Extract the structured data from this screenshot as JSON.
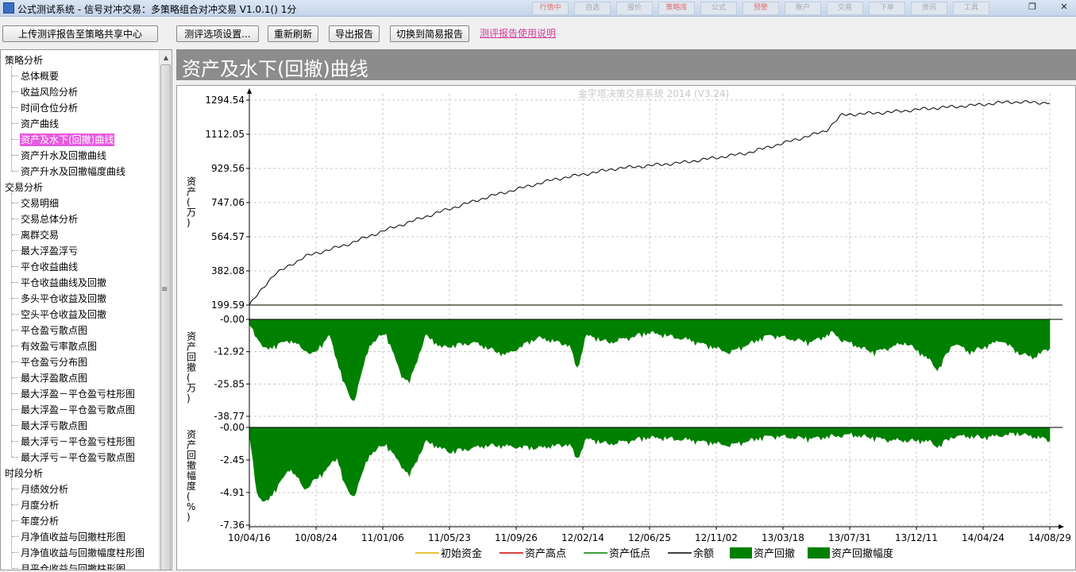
{
  "window": {
    "title": "公式测试系统 - 信号对冲交易：多策略组合对冲交易 V1.0.1() 1分",
    "top_tabs": [
      {
        "label": "行情中",
        "color": "#e07070"
      },
      {
        "label": "自选",
        "color": "#a0a8b0"
      },
      {
        "label": "报价",
        "color": "#a0a8b0"
      },
      {
        "label": "策略库",
        "color": "#e07070"
      },
      {
        "label": "公式",
        "color": "#a0a8b0"
      },
      {
        "label": "预警",
        "color": "#e07070"
      },
      {
        "label": "账户",
        "color": "#a0a8b0"
      },
      {
        "label": "交易",
        "color": "#a0a8b0"
      },
      {
        "label": "下单",
        "color": "#a0a8b0"
      },
      {
        "label": "资讯",
        "color": "#a0a8b0"
      },
      {
        "label": "工具",
        "color": "#a0a8b0"
      }
    ],
    "controls": {
      "restore": "❐",
      "close": "✕"
    }
  },
  "toolbar": {
    "upload": "上传测评报告至策略共享中心",
    "settings": "测评选项设置...",
    "refresh": "重新刷新",
    "export": "导出报告",
    "simple": "切换到简易报告",
    "help_link": "测评报告使用说明"
  },
  "tree": {
    "groups": [
      {
        "label": "策略分析",
        "items": [
          "总体概要",
          "收益风险分析",
          "时间仓位分析",
          "资产曲线",
          "资产及水下(回撤)曲线",
          "资产升水及回撤曲线",
          "资产升水及回撤幅度曲线"
        ]
      },
      {
        "label": "交易分析",
        "items": [
          "交易明细",
          "交易总体分析",
          "离群交易",
          "最大浮盈浮亏",
          "平仓收益曲线",
          "平仓收益曲线及回撤",
          "多头平仓收益及回撤",
          "空头平仓收益及回撤",
          "平仓盈亏散点图",
          "有效盈亏率散点图",
          "平仓盈亏分布图",
          "最大浮盈散点图",
          "最大浮盈－平仓盈亏柱形图",
          "最大浮盈－平仓盈亏散点图",
          "最大浮亏散点图",
          "最大浮亏－平仓盈亏柱形图",
          "最大浮亏－平仓盈亏散点图"
        ]
      },
      {
        "label": "时段分析",
        "items": [
          "月绩效分析",
          "月度分析",
          "年度分析",
          "月净值收益与回撤柱形图",
          "月净值收益与回撤幅度柱形图",
          "月平仓收益与回撤柱形图"
        ]
      }
    ],
    "selected": "资产及水下(回撤)曲线"
  },
  "header": {
    "title": "资产及水下(回撤)曲线"
  },
  "chart_data": {
    "type": "line",
    "watermark": "金字塔决策交易系统 2014 (V3.24)",
    "x_ticks": [
      "10/04/16",
      "10/08/24",
      "11/01/06",
      "11/05/23",
      "11/09/26",
      "12/02/14",
      "12/06/25",
      "12/11/02",
      "13/03/18",
      "13/07/31",
      "13/12/11",
      "14/04/24",
      "14/08/29"
    ],
    "panels": [
      {
        "ylabel": "资产(万)",
        "ylim": [
          199.59,
          1294.54
        ],
        "y_ticks": [
          "1294.54",
          "1112.05",
          "929.56",
          "747.06",
          "564.57",
          "382.08",
          "199.59"
        ],
        "series": [
          {
            "name": "余额",
            "type": "line",
            "color": "#000000",
            "x": [
              0,
              0.03,
              0.07,
              0.12,
              0.17,
              0.24,
              0.3,
              0.38,
              0.46,
              0.54,
              0.62,
              0.68,
              0.72,
              0.74,
              0.8,
              0.85,
              0.9,
              0.95,
              1
            ],
            "y": [
              200,
              360,
              460,
              520,
              600,
              700,
              780,
              870,
              930,
              960,
              1010,
              1080,
              1130,
              1215,
              1230,
              1250,
              1265,
              1285,
              1280
            ]
          },
          {
            "name": "初始资金",
            "type": "line",
            "color": "#e0b000",
            "x": [
              0,
              1
            ],
            "y": [
              200,
              200
            ]
          }
        ]
      },
      {
        "ylabel": "资产回撤(万)",
        "ylim": [
          -38.77,
          0
        ],
        "y_ticks": [
          "-0.00",
          "-12.92",
          "-25.85",
          "-38.77"
        ],
        "series": [
          {
            "name": "资产回撤",
            "type": "area",
            "color": "#008000",
            "x": [
              0,
              0.02,
              0.05,
              0.08,
              0.1,
              0.12,
              0.13,
              0.15,
              0.17,
              0.19,
              0.2,
              0.22,
              0.24,
              0.28,
              0.32,
              0.36,
              0.4,
              0.41,
              0.42,
              0.45,
              0.5,
              0.55,
              0.6,
              0.65,
              0.7,
              0.73,
              0.74,
              0.78,
              0.82,
              0.85,
              0.86,
              0.88,
              0.9,
              0.94,
              0.96,
              0.98,
              1
            ],
            "y": [
              -2,
              -12,
              -8,
              -14,
              -6,
              -27,
              -33,
              -10,
              -5,
              -22,
              -25,
              -6,
              -11,
              -9,
              -14,
              -7,
              -10,
              -20,
              -6,
              -9,
              -5,
              -8,
              -13,
              -6,
              -9,
              -5,
              -8,
              -13,
              -9,
              -16,
              -20,
              -9,
              -13,
              -8,
              -13,
              -15,
              -11
            ]
          }
        ]
      },
      {
        "ylabel": "资产回撤幅度(%)",
        "ylim": [
          -7.36,
          0
        ],
        "y_ticks": [
          "-0.00",
          "-2.45",
          "-4.91",
          "-7.36"
        ],
        "series": [
          {
            "name": "资产回撤幅度",
            "type": "area",
            "color": "#008000",
            "x": [
              0,
              0.01,
              0.02,
              0.04,
              0.05,
              0.07,
              0.09,
              0.11,
              0.12,
              0.13,
              0.15,
              0.17,
              0.19,
              0.2,
              0.22,
              0.25,
              0.3,
              0.36,
              0.4,
              0.41,
              0.42,
              0.45,
              0.5,
              0.55,
              0.6,
              0.65,
              0.7,
              0.75,
              0.8,
              0.85,
              0.86,
              0.88,
              0.92,
              0.96,
              1
            ],
            "y": [
              -0.5,
              -5,
              -5.7,
              -4,
              -3,
              -4.6,
              -3.5,
              -2.2,
              -4.5,
              -5.2,
              -2,
              -1.2,
              -2.8,
              -3.6,
              -1,
              -1.8,
              -1.3,
              -1.5,
              -1.2,
              -2.4,
              -0.8,
              -1.2,
              -0.7,
              -0.9,
              -1.3,
              -0.6,
              -0.8,
              -0.5,
              -0.9,
              -1,
              -1.4,
              -0.6,
              -0.7,
              -0.4,
              -0.9
            ]
          }
        ]
      }
    ],
    "legend": [
      {
        "label": "初始资金",
        "kind": "line",
        "color": "#e0b000"
      },
      {
        "label": "资产高点",
        "kind": "line",
        "color": "#cc0000"
      },
      {
        "label": "资产低点",
        "kind": "line",
        "color": "#008000"
      },
      {
        "label": "余额",
        "kind": "line",
        "color": "#000000"
      },
      {
        "label": "资产回撤",
        "kind": "box",
        "color": "#008000"
      },
      {
        "label": "资产回撤幅度",
        "kind": "box",
        "color": "#008000"
      }
    ]
  }
}
